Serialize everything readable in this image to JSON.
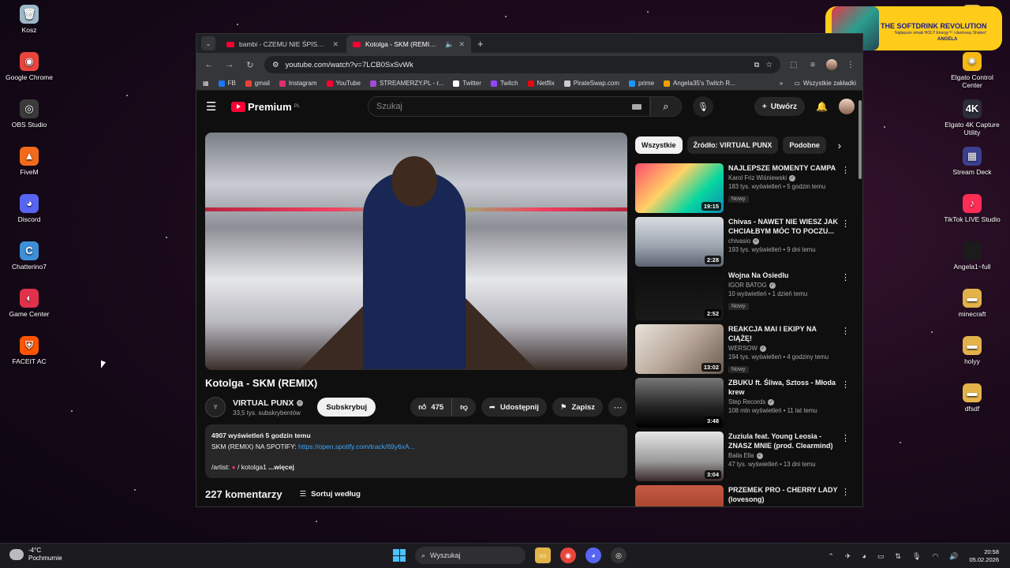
{
  "desktop": {
    "left_icons": [
      {
        "label": "Kosz",
        "icon": "recycle-bin-icon",
        "color": "#9fb8c9",
        "glyph": "🗑"
      },
      {
        "label": "Google Chrome",
        "icon": "chrome-icon",
        "color": "#e8453c",
        "glyph": "◉"
      },
      {
        "label": "OBS Studio",
        "icon": "obs-icon",
        "color": "#3a3a3a",
        "glyph": "◎"
      },
      {
        "label": "FiveM",
        "icon": "fivem-icon",
        "color": "#f26a1b",
        "glyph": "▲"
      },
      {
        "label": "Discord",
        "icon": "discord-icon",
        "color": "#5865f2",
        "glyph": "◕"
      },
      {
        "label": "Chatterino7",
        "icon": "chatterino-icon",
        "color": "#3d8fd8",
        "glyph": "C"
      },
      {
        "label": "Game Center",
        "icon": "game-center-icon",
        "color": "#e0314b",
        "glyph": "◐"
      },
      {
        "label": "FACEIT AC",
        "icon": "faceit-icon",
        "color": "#ff5500",
        "glyph": "⛨"
      }
    ],
    "right_icons": [
      {
        "label": "",
        "icon": "folder-icon",
        "color": "#e3b34a",
        "glyph": "▬"
      },
      {
        "label": "Elgato Control Center",
        "icon": "elgato-icon",
        "color": "#f5b914",
        "glyph": "✺"
      },
      {
        "label": "Elgato 4K Capture Utility",
        "icon": "elgato-4k-icon",
        "color": "#2d2d3a",
        "glyph": "4K"
      },
      {
        "label": "Stream Deck",
        "icon": "stream-deck-icon",
        "color": "#3b3f8f",
        "glyph": "▦"
      },
      {
        "label": "TikTok LIVE Studio",
        "icon": "tiktok-icon",
        "color": "#ff2d55",
        "glyph": "♪"
      },
      {
        "label": "Angela1~full",
        "icon": "file-icon",
        "color": "#1b1b1b",
        "glyph": ""
      },
      {
        "label": "minecraft",
        "icon": "folder-icon",
        "color": "#e3b34a",
        "glyph": "▬"
      },
      {
        "label": "holyy",
        "icon": "folder-icon",
        "color": "#e3b34a",
        "glyph": "▬"
      },
      {
        "label": "dfsdf",
        "icon": "folder-icon",
        "color": "#e3b34a",
        "glyph": "▬"
      }
    ],
    "banner": {
      "title": "THE SOFTDRINK REVOLUTION",
      "subtitle": "Najlepsze smaki HOLY Energy™ i darmowy Shaker!",
      "name": "ANGELA"
    }
  },
  "browser": {
    "tabs": [
      {
        "title": "bambi - CZEMU NIE ŚPISZ? (De",
        "active": false
      },
      {
        "title": "Kotolga - SKM (REMIX) - Yo",
        "active": true
      }
    ],
    "url": "youtube.com/watch?v=7LCB0SxSvWk",
    "bookmarks": [
      {
        "label": "FB",
        "color": "#1877f2"
      },
      {
        "label": "gmail",
        "color": "#ea4335"
      },
      {
        "label": "Instagram",
        "color": "#e1306c"
      },
      {
        "label": "YouTube",
        "color": "#ff0033"
      },
      {
        "label": "STREAMERZY.PL - r...",
        "color": "#a24bd6"
      },
      {
        "label": "Twitter",
        "color": "#ffffff"
      },
      {
        "label": "Twitch",
        "color": "#9146ff"
      },
      {
        "label": "Netflix",
        "color": "#e50914"
      },
      {
        "label": "PirateSwap.com",
        "color": "#cccccc"
      },
      {
        "label": "prime",
        "color": "#1a98ff"
      },
      {
        "label": "Angela35's Twitch R...",
        "color": "#f0a000"
      }
    ],
    "bookmarks_more": "»",
    "all_bookmarks": "Wszystkie zakładki"
  },
  "youtube": {
    "logo_text": "Premium",
    "logo_region": "PL",
    "search_placeholder": "Szukaj",
    "create_label": "Utwórz",
    "video": {
      "title": "Kotolga - SKM (REMIX)",
      "channel": "VIRTUAL PUNX",
      "subscribers": "33,5 tys. subskrybentów",
      "subscribe_label": "Subskrybuj",
      "likes": "475",
      "share_label": "Udostępnij",
      "save_label": "Zapisz",
      "desc_meta": "4907 wyświetleń  5 godzin temu",
      "desc_line1_prefix": "SKM (REMIX) NA SPOTIFY: ",
      "desc_link": "https://open.spotify.com/track/69y6xA...",
      "desc_artist": "/artist: ",
      "desc_artist_handle": " / kotolga1",
      "desc_more": " ...więcej",
      "comments_count": "227 komentarzy",
      "sort_label": "Sortuj według"
    },
    "chips": [
      {
        "label": "Wszystkie",
        "active": true
      },
      {
        "label": "Źródło: VIRTUAL PUNX",
        "active": false
      },
      {
        "label": "Podobne",
        "active": false
      }
    ],
    "recommendations": [
      {
        "title": "NAJLEPSZE MOMENTY CAMPA",
        "channel": "Karol Friz Wiśniewski",
        "stats": "183 tys. wyświetleń • 5 godzin temu",
        "badge": "Nowy",
        "duration": "19:15",
        "thumb": "linear-gradient(135deg,#ff4d6d,#ffd166 40%,#06d6a0 70%,#118ab2)"
      },
      {
        "title": "Chivas - NAWET NIE WIESZ JAK CHCIAŁBYM MÓC TO POCZU...",
        "channel": "chivasio",
        "stats": "193 tys. wyświetleń • 9 dni temu",
        "badge": "",
        "duration": "2:28",
        "thumb": "linear-gradient(180deg,#d9dde2,#9aa3ad 60%,#5b6470)"
      },
      {
        "title": "Wojna Na Osiedlu",
        "channel": "IGOR BATOG",
        "stats": "10 wyświetleń • 1 dzień temu",
        "badge": "Nowy",
        "duration": "2:52",
        "thumb": "linear-gradient(180deg,#0e0e0e,#1a1a1a)"
      },
      {
        "title": "REAKCJA MAI I EKIPY NA CIĄŻĘ!",
        "channel": "WERSOW",
        "stats": "194 tys. wyświetleń • 4 godziny temu",
        "badge": "Nowy",
        "duration": "13:02",
        "thumb": "linear-gradient(135deg,#e8e2da,#b9a89a 50%,#6a5a50)"
      },
      {
        "title": "ZBUKU ft. Śliwa, Sztoss - Młoda krew",
        "channel": "Step Records",
        "stats": "108 mln wyświetleń • 11 lat temu",
        "badge": "",
        "duration": "3:48",
        "thumb": "linear-gradient(180deg,#777,#222 60%,#000)"
      },
      {
        "title": "Zuziula feat. Young Leosia - ZNASZ MNIE (prod. Clearmind)",
        "channel": "Baila Ella",
        "stats": "47 tys. wyświetleń • 13 dni temu",
        "badge": "",
        "duration": "3:04",
        "thumb": "linear-gradient(180deg,#e6e6e6,#9a9a9a 60%,#3a2a2a)"
      },
      {
        "title": "PRZEMEK PRO - CHERRY LADY (lovesong)",
        "channel": "",
        "stats": "",
        "badge": "",
        "duration": "",
        "thumb": "linear-gradient(180deg,#c45a42,#8a2c1e)"
      }
    ]
  },
  "taskbar": {
    "temperature": "-4°C",
    "weather": "Pochmurnie",
    "search_label": "Wyszukaj",
    "time": "20:58",
    "date": "05.02.2026"
  }
}
